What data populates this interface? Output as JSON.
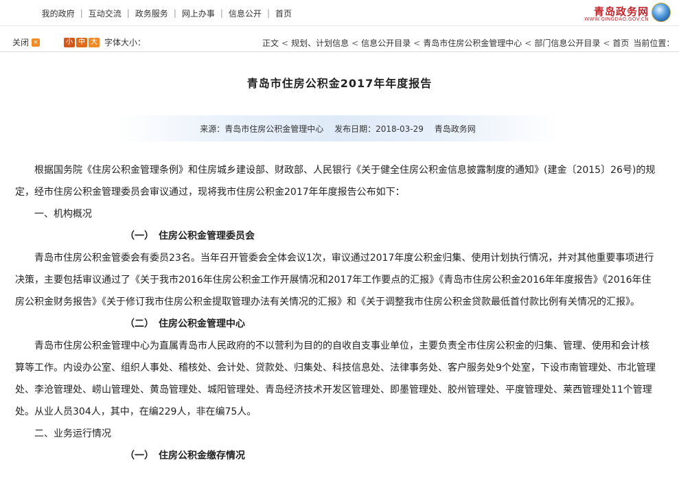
{
  "header": {
    "nav": [
      "首页",
      "信息公开",
      "网上办事",
      "政务服务",
      "互动交流",
      "我的政府"
    ],
    "logo_brand": "青岛政务网",
    "logo_sub": "WWW.QINGDAO.GOV.CN"
  },
  "breadcrumb": {
    "label": "当前位置：",
    "items": [
      "首页",
      "部门信息公开目录",
      "青岛市住房公积金管理中心",
      "信息公开目录",
      "规划、计划信息",
      "正文"
    ]
  },
  "font_control": {
    "label": "字体大小：",
    "sizes": [
      "大",
      "中",
      "小"
    ],
    "close_label": "关闭",
    "close_icon": "close-icon"
  },
  "article": {
    "title": "青岛市住房公积金2017年年度报告",
    "meta_publish": "发布日期：2018-03-29",
    "meta_source": "来源：青岛市住房公积金管理中心",
    "meta_site": "青岛政务网",
    "paragraphs": [
      {
        "type": "para",
        "text": "根据国务院《住房公积金管理条例》和住房城乡建设部、财政部、人民银行《关于健全住房公积金信息披露制度的通知》(建金〔2015〕26号)的规定，经市住房公积金管理委员会审议通过，现将我市住房公积金2017年年度报告公布如下："
      },
      {
        "type": "plain",
        "text": "一、机构概况"
      },
      {
        "type": "h",
        "text": "（一）　住房公积金管理委员会"
      },
      {
        "type": "para",
        "text": "青岛市住房公积金管委会有委员23名。当年召开管委会全体会议1次，审议通过2017年度公积金归集、使用计划执行情况，并对其他重要事项进行决策，主要包括审议通过了《关于我市2016年住房公积金工作开展情况和2017年工作要点的汇报》《青岛市住房公积金2016年年度报告》《2016年住房公积金财务报告》《关于修订我市住房公积金提取管理办法有关情况的汇报》和《关于调整我市住房公积金贷款最低首付款比例有关情况的汇报》。"
      },
      {
        "type": "h",
        "text": "（二）　住房公积金管理中心"
      },
      {
        "type": "para",
        "text": "青岛市住房公积金管理中心为直属青岛市人民政府的不以营利为目的的自收自支事业单位，主要负责全市住房公积金的归集、管理、使用和会计核算等工作。内设办公室、组织人事处、稽核处、会计处、贷款处、归集处、科技信息处、法律事务处、客户服务处9个处室，下设市南管理处、市北管理处、李沧管理处、崂山管理处、黄岛管理处、城阳管理处、青岛经济技术开发区管理处、即墨管理处、胶州管理处、平度管理处、莱西管理处11个管理处。从业人员304人，其中，在编229人，非在编75人。"
      },
      {
        "type": "plain",
        "text": "二、业务运行情况"
      },
      {
        "type": "h",
        "text": "（一）　住房公积金缴存情况"
      }
    ]
  }
}
